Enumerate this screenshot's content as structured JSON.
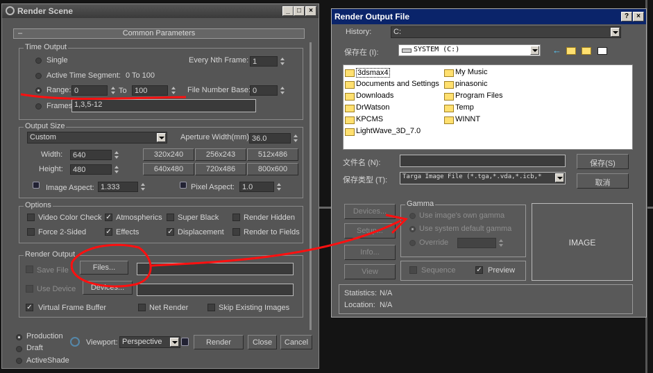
{
  "render_scene": {
    "title": "Render Scene",
    "rollout": "Common Parameters",
    "rollout_toggle": "–",
    "time_output": {
      "label": "Time Output",
      "single": "Single",
      "every_nth": "Every Nth Frame:",
      "every_nth_value": "1",
      "active_segment": "Active Time Segment:",
      "active_range": "0 To 100",
      "range": "Range:",
      "range_from": "0",
      "to": "To",
      "range_to": "100",
      "file_number_base": "File Number Base:",
      "file_number_base_value": "0",
      "frames": "Frames",
      "frames_value": "1,3,5-12"
    },
    "output_size": {
      "label": "Output Size",
      "preset": "Custom",
      "aperture_label": "Aperture Width(mm):",
      "aperture_value": "36.0",
      "width_label": "Width:",
      "width_value": "640",
      "height_label": "Height:",
      "height_value": "480",
      "presets": [
        "320x240",
        "256x243",
        "512x486",
        "640x480",
        "720x486",
        "800x600"
      ],
      "image_aspect_label": "Image Aspect:",
      "image_aspect_value": "1.333",
      "pixel_aspect_label": "Pixel Aspect:",
      "pixel_aspect_value": "1.0"
    },
    "options": {
      "label": "Options",
      "items": [
        "Video Color Check",
        "Atmospherics",
        "Super Black",
        "Render Hidden",
        "Force 2-Sided",
        "Effects",
        "Displacement",
        "Render to Fields"
      ]
    },
    "render_output": {
      "label": "Render Output",
      "save_file": "Save File",
      "files_button": "Files...",
      "use_device": "Use Device",
      "devices_button": "Devices...",
      "virtual_frame_buffer": "Virtual Frame Buffer",
      "net_render": "Net Render",
      "skip_existing": "Skip Existing Images"
    },
    "bottom": {
      "production": "Production",
      "draft": "Draft",
      "activeshade": "ActiveShade",
      "viewport_label": "Viewport:",
      "viewport_value": "Perspective",
      "render": "Render",
      "close": "Close",
      "cancel": "Cancel"
    }
  },
  "render_output_file": {
    "title": "Render Output File",
    "history_label": "History:",
    "history_value": "C:",
    "save_in_label": "保存在 (I):",
    "save_in_value": "SYSTEM  (C:)",
    "folders_col1": [
      "3dsmax4",
      "Documents and Settings",
      "Downloads",
      "DrWatson",
      "KPCMS",
      "LightWave_3D_7.0"
    ],
    "folders_col2": [
      "My Music",
      "pinasonic",
      "Program Files",
      "Temp",
      "WINNT"
    ],
    "filename_label": "文件名 (N):",
    "filename_value": "",
    "filetype_label": "保存类型 (T):",
    "filetype_value": "Targa Image File (*.tga,*.vda,*.icb,*",
    "save_button": "保存(S)",
    "cancel_button": "取消",
    "devices_button": "Devices...",
    "setup_button": "Setup...",
    "info_button": "Info...",
    "view_button": "View",
    "gamma_label": "Gamma",
    "gamma_own": "Use image's own gamma",
    "gamma_default": "Use system default gamma",
    "gamma_override": "Override",
    "sequence": "Sequence",
    "preview": "Preview",
    "image_label": "IMAGE",
    "statistics_label": "Statistics:",
    "statistics_value": "N/A",
    "location_label": "Location:",
    "location_value": "N/A"
  }
}
